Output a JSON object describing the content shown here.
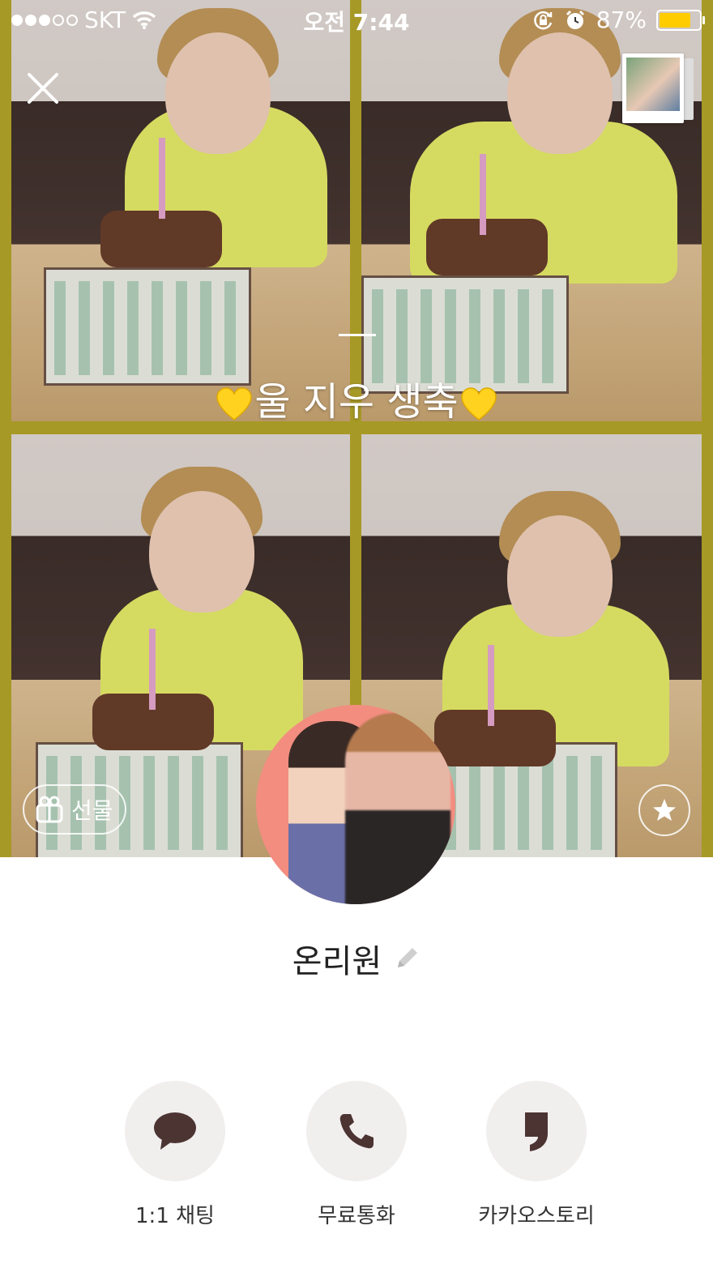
{
  "status_bar": {
    "carrier": "SKT",
    "time": "오전 7:44",
    "battery_percent": "87%",
    "battery_level": 0.87,
    "signal_bars_filled": 3,
    "signal_bars_total": 5
  },
  "profile": {
    "status_message": "울 지우 생축",
    "name": "온리원"
  },
  "buttons": {
    "gift_label": "선물"
  },
  "actions": [
    {
      "label": "1:1 채팅",
      "icon": "chat-bubble-icon"
    },
    {
      "label": "무료통화",
      "icon": "phone-icon"
    },
    {
      "label": "카카오스토리",
      "icon": "kakaostory-icon"
    }
  ],
  "colors": {
    "accent_brown": "#4b3432",
    "battery_yellow": "#ffcc00",
    "avatar_ring": "#f28d80",
    "action_circle": "#f1eeee"
  }
}
